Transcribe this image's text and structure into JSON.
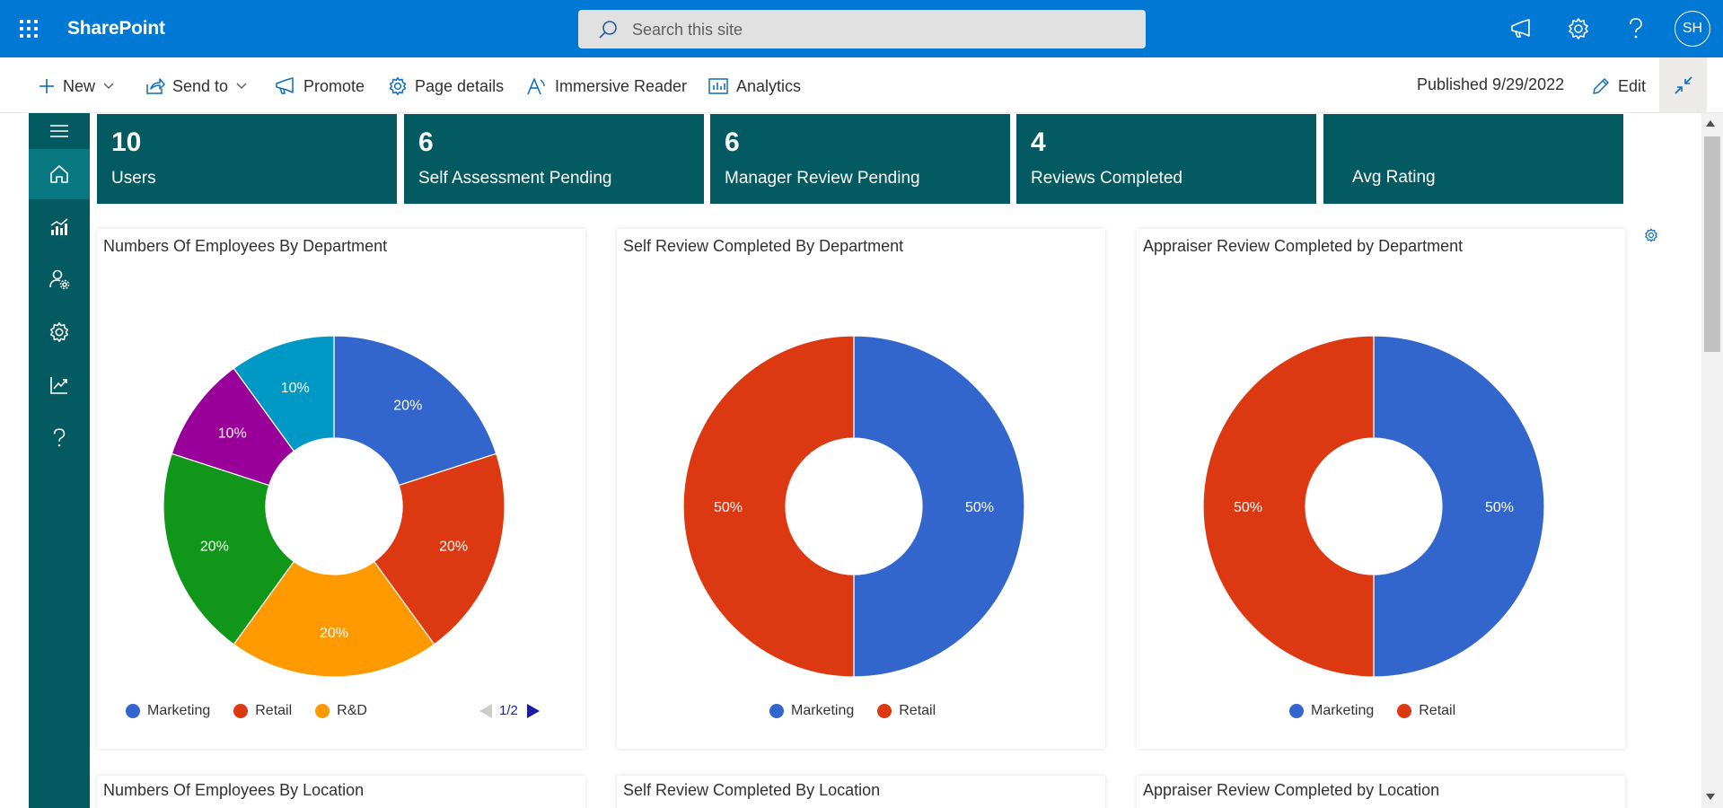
{
  "suite_bar": {
    "brand": "SharePoint",
    "search_placeholder": "Search this site",
    "avatar_initials": "SH",
    "icons": [
      "waffle-icon",
      "megaphone-icon",
      "gear-icon",
      "help-icon"
    ]
  },
  "command_bar": {
    "new_label": "New",
    "send_to_label": "Send to",
    "promote_label": "Promote",
    "page_details_label": "Page details",
    "immersive_reader_label": "Immersive Reader",
    "analytics_label": "Analytics",
    "published_label": "Published 9/29/2022",
    "edit_label": "Edit"
  },
  "left_nav": {
    "items": [
      "menu-icon",
      "home-icon",
      "dashboard-chart-icon",
      "user-settings-icon",
      "settings-icon",
      "trend-icon",
      "help-icon"
    ],
    "active": "home-icon"
  },
  "tiles": [
    {
      "value": "10",
      "label": "Users"
    },
    {
      "value": "6",
      "label": "Self Assessment Pending"
    },
    {
      "value": "6",
      "label": "Manager Review Pending"
    },
    {
      "value": "4",
      "label": "Reviews Completed"
    },
    {
      "value": "",
      "label": "Avg Rating"
    }
  ],
  "colors": {
    "suite_bar": "#0078d4",
    "teal": "#035a60",
    "marketing": "#3366cc",
    "retail": "#dc3912",
    "rnd": "#ff9900",
    "green": "#109618",
    "purple": "#990099",
    "cyan": "#0099c6"
  },
  "chart_data": [
    {
      "type": "pie",
      "donut": true,
      "title": "Numbers Of Employees By Department",
      "slices": [
        {
          "name": "Marketing",
          "value": 20,
          "label": "20%",
          "color": "#3366cc"
        },
        {
          "name": "Retail",
          "value": 20,
          "label": "20%",
          "color": "#dc3912"
        },
        {
          "name": "R&D",
          "value": 20,
          "label": "20%",
          "color": "#ff9900"
        },
        {
          "name": "",
          "value": 20,
          "label": "20%",
          "color": "#109618"
        },
        {
          "name": "",
          "value": 10,
          "label": "10%",
          "color": "#990099"
        },
        {
          "name": "",
          "value": 10,
          "label": "10%",
          "color": "#0099c6"
        }
      ],
      "legend": [
        "Marketing",
        "Retail",
        "R&D"
      ],
      "legend_placement": "bottom",
      "legend_page": "1/2"
    },
    {
      "type": "pie",
      "donut": true,
      "title": "Self Review Completed By Department",
      "slices": [
        {
          "name": "Marketing",
          "value": 50,
          "label": "50%",
          "color": "#3366cc"
        },
        {
          "name": "Retail",
          "value": 50,
          "label": "50%",
          "color": "#dc3912"
        }
      ],
      "legend": [
        "Marketing",
        "Retail"
      ],
      "legend_placement": "bottom"
    },
    {
      "type": "pie",
      "donut": true,
      "title": "Appraiser Review Completed by Department",
      "slices": [
        {
          "name": "Marketing",
          "value": 50,
          "label": "50%",
          "color": "#3366cc"
        },
        {
          "name": "Retail",
          "value": 50,
          "label": "50%",
          "color": "#dc3912"
        }
      ],
      "legend": [
        "Marketing",
        "Retail"
      ],
      "legend_placement": "bottom"
    }
  ],
  "second_row_titles": [
    "Numbers Of Employees By Location",
    "Self Review Completed By Location",
    "Appraiser Review Completed by Location"
  ]
}
